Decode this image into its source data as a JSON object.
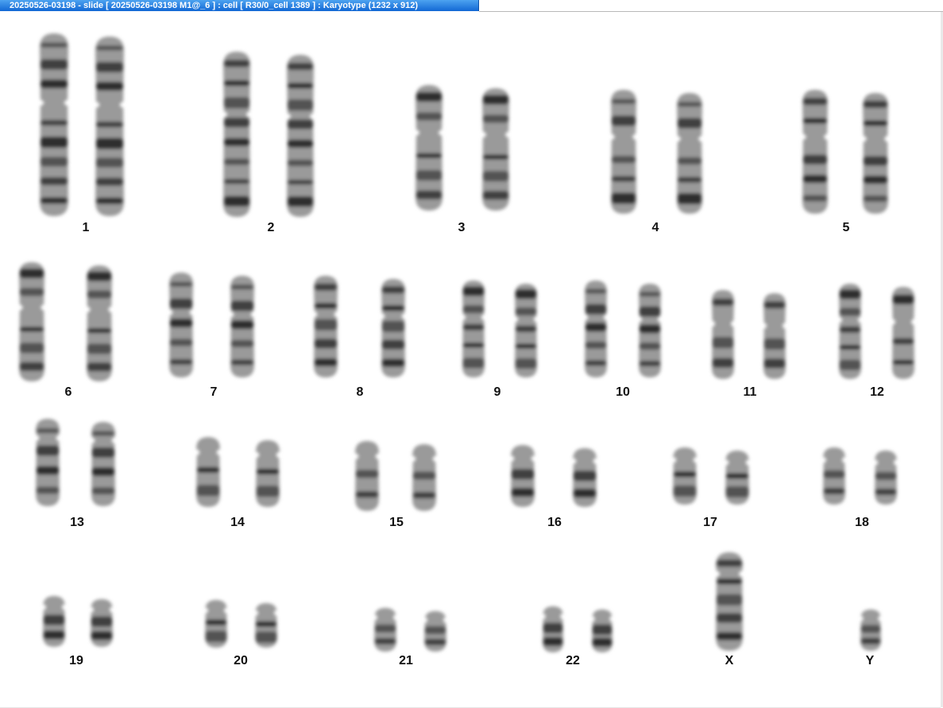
{
  "window": {
    "title": "20250526-03198 - slide [ 20250526-03198 M1@_6 ] : cell [ R30/0_cell 1389 ] : Karyotype  (1232 x 912)"
  },
  "karyotype": {
    "labels": [
      "1",
      "2",
      "3",
      "4",
      "5",
      "6",
      "7",
      "8",
      "9",
      "10",
      "11",
      "12",
      "13",
      "14",
      "15",
      "16",
      "17",
      "18",
      "19",
      "20",
      "21",
      "22",
      "X",
      "Y"
    ]
  },
  "colors": {
    "titlebar": "#1a73d9",
    "chromosome_dark": "#1a1a1a",
    "chromosome_light": "#9a9a9a"
  }
}
